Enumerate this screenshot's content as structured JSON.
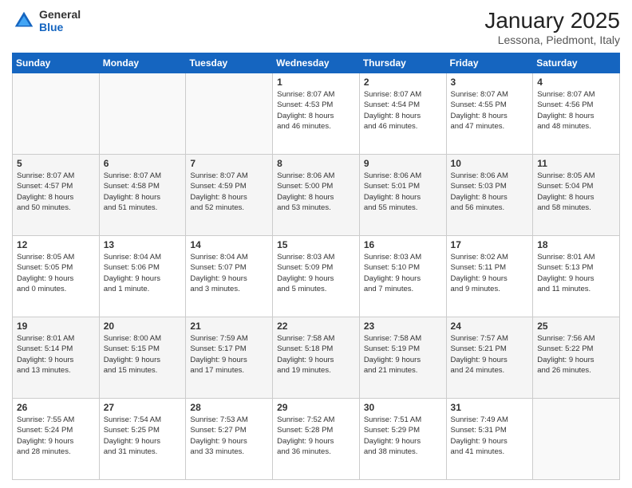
{
  "header": {
    "logo_general": "General",
    "logo_blue": "Blue",
    "month_title": "January 2025",
    "location": "Lessona, Piedmont, Italy"
  },
  "days_of_week": [
    "Sunday",
    "Monday",
    "Tuesday",
    "Wednesday",
    "Thursday",
    "Friday",
    "Saturday"
  ],
  "weeks": [
    [
      {
        "day": "",
        "info": ""
      },
      {
        "day": "",
        "info": ""
      },
      {
        "day": "",
        "info": ""
      },
      {
        "day": "1",
        "info": "Sunrise: 8:07 AM\nSunset: 4:53 PM\nDaylight: 8 hours\nand 46 minutes."
      },
      {
        "day": "2",
        "info": "Sunrise: 8:07 AM\nSunset: 4:54 PM\nDaylight: 8 hours\nand 46 minutes."
      },
      {
        "day": "3",
        "info": "Sunrise: 8:07 AM\nSunset: 4:55 PM\nDaylight: 8 hours\nand 47 minutes."
      },
      {
        "day": "4",
        "info": "Sunrise: 8:07 AM\nSunset: 4:56 PM\nDaylight: 8 hours\nand 48 minutes."
      }
    ],
    [
      {
        "day": "5",
        "info": "Sunrise: 8:07 AM\nSunset: 4:57 PM\nDaylight: 8 hours\nand 50 minutes."
      },
      {
        "day": "6",
        "info": "Sunrise: 8:07 AM\nSunset: 4:58 PM\nDaylight: 8 hours\nand 51 minutes."
      },
      {
        "day": "7",
        "info": "Sunrise: 8:07 AM\nSunset: 4:59 PM\nDaylight: 8 hours\nand 52 minutes."
      },
      {
        "day": "8",
        "info": "Sunrise: 8:06 AM\nSunset: 5:00 PM\nDaylight: 8 hours\nand 53 minutes."
      },
      {
        "day": "9",
        "info": "Sunrise: 8:06 AM\nSunset: 5:01 PM\nDaylight: 8 hours\nand 55 minutes."
      },
      {
        "day": "10",
        "info": "Sunrise: 8:06 AM\nSunset: 5:03 PM\nDaylight: 8 hours\nand 56 minutes."
      },
      {
        "day": "11",
        "info": "Sunrise: 8:05 AM\nSunset: 5:04 PM\nDaylight: 8 hours\nand 58 minutes."
      }
    ],
    [
      {
        "day": "12",
        "info": "Sunrise: 8:05 AM\nSunset: 5:05 PM\nDaylight: 9 hours\nand 0 minutes."
      },
      {
        "day": "13",
        "info": "Sunrise: 8:04 AM\nSunset: 5:06 PM\nDaylight: 9 hours\nand 1 minute."
      },
      {
        "day": "14",
        "info": "Sunrise: 8:04 AM\nSunset: 5:07 PM\nDaylight: 9 hours\nand 3 minutes."
      },
      {
        "day": "15",
        "info": "Sunrise: 8:03 AM\nSunset: 5:09 PM\nDaylight: 9 hours\nand 5 minutes."
      },
      {
        "day": "16",
        "info": "Sunrise: 8:03 AM\nSunset: 5:10 PM\nDaylight: 9 hours\nand 7 minutes."
      },
      {
        "day": "17",
        "info": "Sunrise: 8:02 AM\nSunset: 5:11 PM\nDaylight: 9 hours\nand 9 minutes."
      },
      {
        "day": "18",
        "info": "Sunrise: 8:01 AM\nSunset: 5:13 PM\nDaylight: 9 hours\nand 11 minutes."
      }
    ],
    [
      {
        "day": "19",
        "info": "Sunrise: 8:01 AM\nSunset: 5:14 PM\nDaylight: 9 hours\nand 13 minutes."
      },
      {
        "day": "20",
        "info": "Sunrise: 8:00 AM\nSunset: 5:15 PM\nDaylight: 9 hours\nand 15 minutes."
      },
      {
        "day": "21",
        "info": "Sunrise: 7:59 AM\nSunset: 5:17 PM\nDaylight: 9 hours\nand 17 minutes."
      },
      {
        "day": "22",
        "info": "Sunrise: 7:58 AM\nSunset: 5:18 PM\nDaylight: 9 hours\nand 19 minutes."
      },
      {
        "day": "23",
        "info": "Sunrise: 7:58 AM\nSunset: 5:19 PM\nDaylight: 9 hours\nand 21 minutes."
      },
      {
        "day": "24",
        "info": "Sunrise: 7:57 AM\nSunset: 5:21 PM\nDaylight: 9 hours\nand 24 minutes."
      },
      {
        "day": "25",
        "info": "Sunrise: 7:56 AM\nSunset: 5:22 PM\nDaylight: 9 hours\nand 26 minutes."
      }
    ],
    [
      {
        "day": "26",
        "info": "Sunrise: 7:55 AM\nSunset: 5:24 PM\nDaylight: 9 hours\nand 28 minutes."
      },
      {
        "day": "27",
        "info": "Sunrise: 7:54 AM\nSunset: 5:25 PM\nDaylight: 9 hours\nand 31 minutes."
      },
      {
        "day": "28",
        "info": "Sunrise: 7:53 AM\nSunset: 5:27 PM\nDaylight: 9 hours\nand 33 minutes."
      },
      {
        "day": "29",
        "info": "Sunrise: 7:52 AM\nSunset: 5:28 PM\nDaylight: 9 hours\nand 36 minutes."
      },
      {
        "day": "30",
        "info": "Sunrise: 7:51 AM\nSunset: 5:29 PM\nDaylight: 9 hours\nand 38 minutes."
      },
      {
        "day": "31",
        "info": "Sunrise: 7:49 AM\nSunset: 5:31 PM\nDaylight: 9 hours\nand 41 minutes."
      },
      {
        "day": "",
        "info": ""
      }
    ]
  ]
}
